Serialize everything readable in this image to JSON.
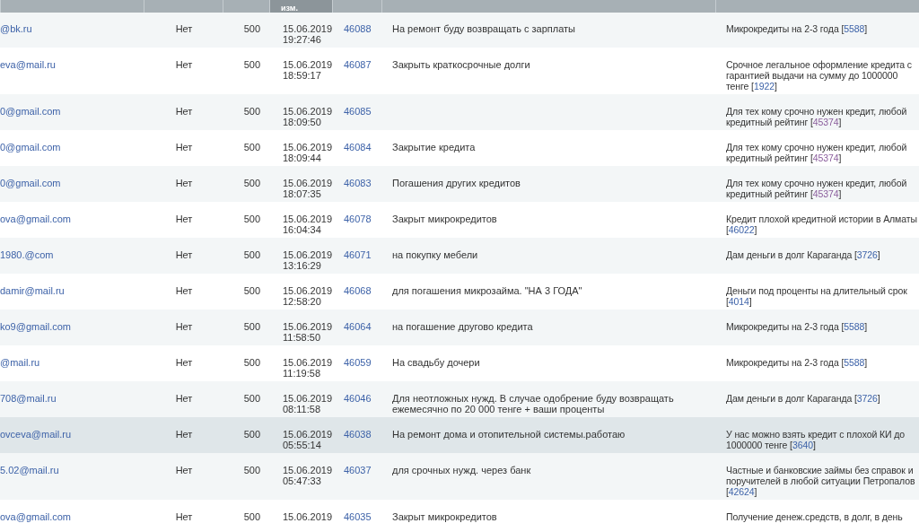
{
  "header_cells": [
    {
      "sorted": false
    },
    {
      "sorted": false
    },
    {
      "sorted": false
    },
    {
      "sorted": true,
      "label": "изм."
    },
    {
      "sorted": false
    },
    {
      "sorted": false
    },
    {
      "sorted": false
    }
  ],
  "rows": [
    {
      "email": "@bk.ru",
      "active": "Нет",
      "sum": "500",
      "date": "15.06.2019",
      "time": "19:27:46",
      "id": "46088",
      "comment": "На ремонт буду возвращать с зарплаты",
      "offer": {
        "text": "Микрокредиты на 2-3 года",
        "open": "[",
        "link": "5588",
        "close": "]",
        "visited": false
      },
      "selected": false
    },
    {
      "email": "eva@mail.ru",
      "active": "Нет",
      "sum": "500",
      "date": "15.06.2019",
      "time": "18:59:17",
      "id": "46087",
      "comment": "Закрыть краткосрочные долги",
      "offer": {
        "text": "Срочное легальное оформление кредита с гарантией выдачи на сумму до 1000000 тенге",
        "open": "[",
        "link": "1922",
        "close": "]",
        "visited": false
      },
      "selected": false
    },
    {
      "email": "0@gmail.com",
      "active": "Нет",
      "sum": "500",
      "date": "15.06.2019",
      "time": "18:09:50",
      "id": "46085",
      "offer": {
        "text": "Для тех кому срочно нужен кредит, любой кредитный рейтинг",
        "open": "[",
        "link": "45374",
        "close": "]",
        "visited": true
      },
      "selected": false
    },
    {
      "email": "0@gmail.com",
      "active": "Нет",
      "sum": "500",
      "date": "15.06.2019",
      "time": "18:09:44",
      "id": "46084",
      "comment": "Закрытие кредита",
      "offer": {
        "text": "Для тех кому срочно нужен кредит, любой кредитный рейтинг",
        "open": "[",
        "link": "45374",
        "close": "]",
        "visited": true
      },
      "selected": false
    },
    {
      "email": "0@gmail.com",
      "active": "Нет",
      "sum": "500",
      "date": "15.06.2019",
      "time": "18:07:35",
      "id": "46083",
      "comment": "Погашения других кредитов",
      "offer": {
        "text": "Для тех кому срочно нужен кредит, любой кредитный рейтинг",
        "open": "[",
        "link": "45374",
        "close": "]",
        "visited": true
      },
      "selected": false
    },
    {
      "email": "ova@gmail.com",
      "active": "Нет",
      "sum": "500",
      "date": "15.06.2019",
      "time": "16:04:34",
      "id": "46078",
      "comment": "Закрыт микрокредитов",
      "offer": {
        "text": "Кредит плохой кредитной истории в Алматы",
        "open": "[",
        "link": "46022",
        "close": "]",
        "visited": false
      },
      "selected": false
    },
    {
      "email": "1980.@com",
      "active": "Нет",
      "sum": "500",
      "date": "15.06.2019",
      "time": "13:16:29",
      "id": "46071",
      "comment": "на покупку мебели",
      "offer": {
        "text": "Дам деньги в долг Караганда",
        "open": "[",
        "link": "3726",
        "close": "]",
        "visited": false
      },
      "selected": false
    },
    {
      "email": "damir@mail.ru",
      "active": "Нет",
      "sum": "500",
      "date": "15.06.2019",
      "time": "12:58:20",
      "id": "46068",
      "comment": "для погашения микрозайма. \"НА 3 ГОДА\"",
      "offer": {
        "text": "Деньги под проценты на длительный срок",
        "open": "[",
        "link": "4014",
        "close": "]",
        "visited": false
      },
      "selected": false
    },
    {
      "email": "ko9@gmail.com",
      "active": "Нет",
      "sum": "500",
      "date": "15.06.2019",
      "time": "11:58:50",
      "id": "46064",
      "comment": "на погашение другово кредита",
      "offer": {
        "text": "Микрокредиты на 2-3 года",
        "open": "[",
        "link": "5588",
        "close": "]",
        "visited": false
      },
      "selected": false
    },
    {
      "email": "@mail.ru",
      "active": "Нет",
      "sum": "500",
      "date": "15.06.2019",
      "time": "11:19:58",
      "id": "46059",
      "comment": "На свадьбу дочери",
      "offer": {
        "text": "Микрокредиты на 2-3 года",
        "open": "[",
        "link": "5588",
        "close": "]",
        "visited": false
      },
      "selected": false
    },
    {
      "email": "708@mail.ru",
      "active": "Нет",
      "sum": "500",
      "date": "15.06.2019",
      "time": "08:11:58",
      "id": "46046",
      "comment": "Для неотложных нужд. В случае одобрение буду возвращать ежемесячно по 20 000 тенге + ваши проценты",
      "offer": {
        "text": "Дам деньги в долг Караганда",
        "open": "[",
        "link": "3726",
        "close": "]",
        "visited": false
      },
      "selected": false
    },
    {
      "email": "ovceva@mail.ru",
      "active": "Нет",
      "sum": "500",
      "date": "15.06.2019",
      "time": "05:55:14",
      "id": "46038",
      "comment": "На ремонт дома и отопительной системы.работаю",
      "offer": {
        "text": "У нас можно взять кредит с плохой КИ до 1000000 тенге",
        "open": "[",
        "link": "3640",
        "close": "]",
        "visited": false
      },
      "selected": true
    },
    {
      "email": "5.02@mail.ru",
      "active": "Нет",
      "sum": "500",
      "date": "15.06.2019",
      "time": "05:47:33",
      "id": "46037",
      "comment": "для срочных нужд. через банк",
      "offer": {
        "text": "Частные и банковские займы без справок и поручителей в любой ситуации Петропалов",
        "open": "[",
        "link": "42624",
        "close": "]",
        "visited": false
      },
      "selected": false
    },
    {
      "email": "ova@gmail.com",
      "active": "Нет",
      "sum": "500",
      "date": "15.06.2019",
      "id": "46035",
      "comment": "Закрыт микрокредитов",
      "offer": {
        "text": "Получение денеж.средств, в долг, в день"
      },
      "selected": false
    }
  ]
}
